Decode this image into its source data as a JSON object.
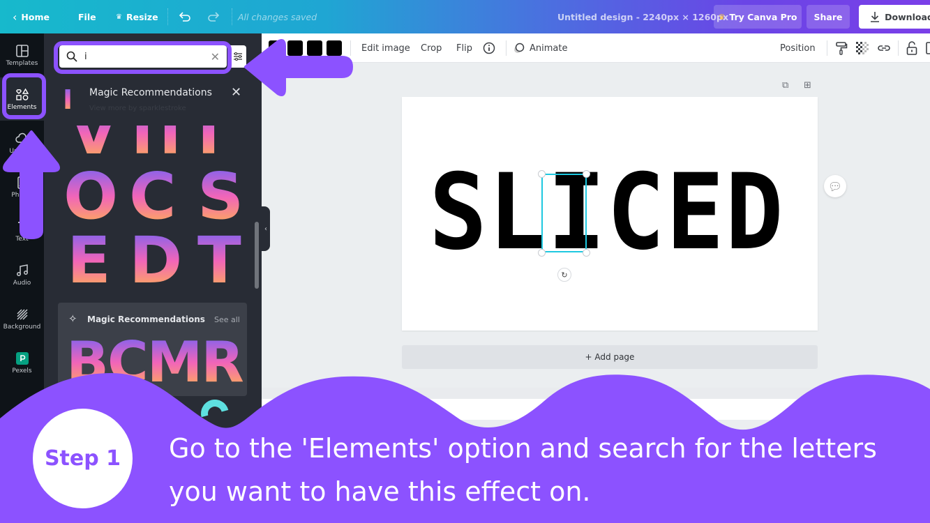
{
  "header": {
    "home": "Home",
    "file": "File",
    "resize": "Resize",
    "saved_status": "All changes saved",
    "design_title": "Untitled design - 2240px × 1260px",
    "try_pro": "Try Canva Pro",
    "share": "Share",
    "download": "Download"
  },
  "rail": {
    "items": [
      {
        "label": "Templates",
        "icon": "templates-icon"
      },
      {
        "label": "Elements",
        "icon": "elements-icon",
        "active": true
      },
      {
        "label": "Uploads",
        "icon": "uploads-icon"
      },
      {
        "label": "Photos",
        "icon": "photos-icon"
      },
      {
        "label": "Text",
        "icon": "text-icon"
      },
      {
        "label": "Audio",
        "icon": "audio-icon"
      },
      {
        "label": "Background",
        "icon": "background-icon"
      },
      {
        "label": "Pexels",
        "icon": "pexels-icon"
      }
    ]
  },
  "panel": {
    "search_value": "i",
    "recommendation_title": "Magic Recommendations",
    "recommendation_sub": "View more by sparklestroke",
    "grid_letters": [
      "V",
      "П",
      "Г",
      "O",
      "C",
      "S",
      "E",
      "D",
      "T"
    ],
    "card_title": "Magic Recommendations",
    "card_see_all": "See all",
    "card_letters": "BCMR"
  },
  "toolbar": {
    "edit_image": "Edit image",
    "crop": "Crop",
    "flip": "Flip",
    "animate": "Animate",
    "position": "Position"
  },
  "canvas": {
    "text": "SLICED",
    "selection_color": "#1ec8e0",
    "add_page": "+ Add page"
  },
  "banner": {
    "step": "Step 1",
    "instruction": "Go to the 'Elements' option and search for the letters you want to have this effect on.",
    "color": "#8c52ff"
  }
}
